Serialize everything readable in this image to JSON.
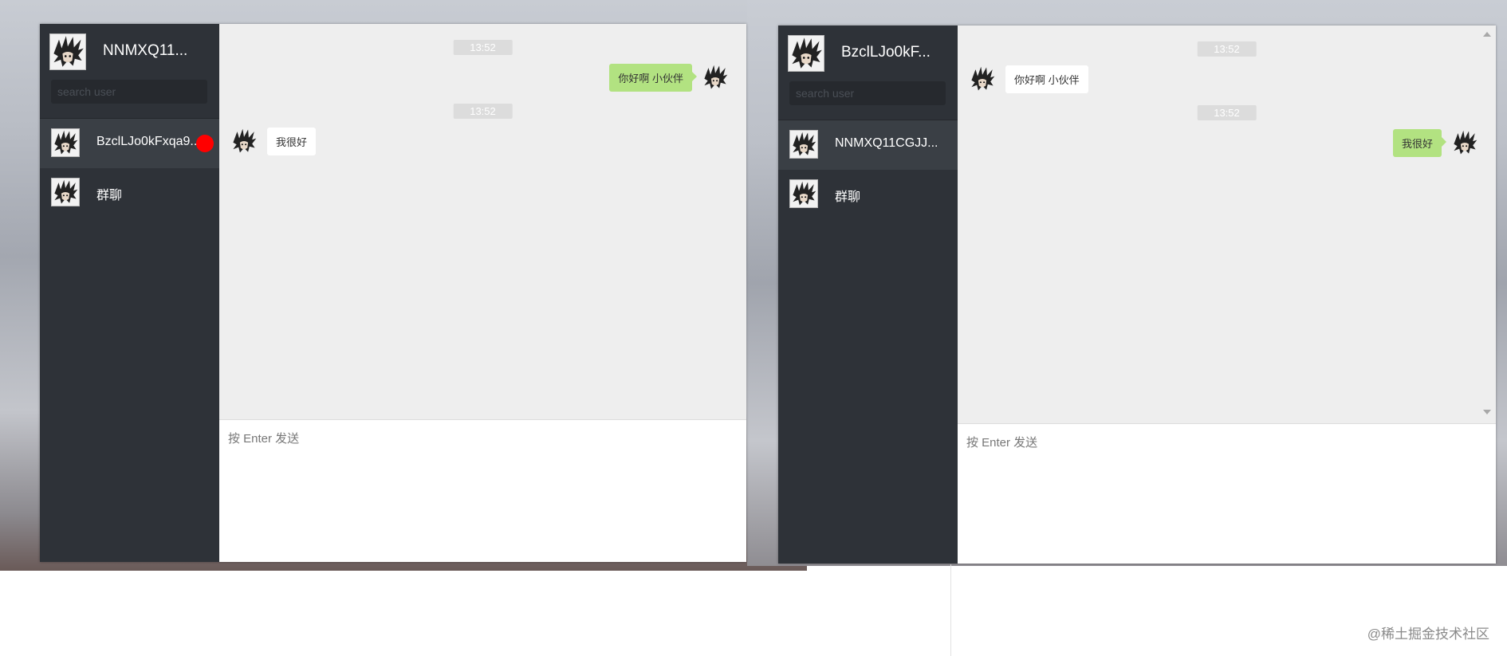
{
  "left_window": {
    "profile_name": "NNMXQ11...",
    "search_placeholder": "search user",
    "contacts": [
      {
        "name": "BzclLJo0kFxqa9...",
        "unread": true
      },
      {
        "name": "群聊",
        "unread": false
      }
    ],
    "messages": [
      {
        "time": "13:52",
        "direction": "out",
        "text": "你好啊 小伙伴"
      },
      {
        "time": "13:52",
        "direction": "in",
        "text": "我很好"
      }
    ],
    "input_placeholder": "按 Enter 发送"
  },
  "right_window": {
    "profile_name": "BzclLJo0kF...",
    "search_placeholder": "search user",
    "contacts": [
      {
        "name": "NNMXQ11CGJJ...",
        "unread": false
      },
      {
        "name": "群聊",
        "unread": false
      }
    ],
    "messages": [
      {
        "time": "13:52",
        "direction": "in",
        "text": "你好啊 小伙伴"
      },
      {
        "time": "13:52",
        "direction": "out",
        "text": "我很好"
      }
    ],
    "input_placeholder": "按 Enter 发送"
  },
  "watermark": "@稀土掘金技术社区",
  "colors": {
    "sidebar": "#2e3238",
    "active_contact": "#3a3f45",
    "out_bubble": "#b2e281",
    "unread_badge": "#ff0000"
  }
}
